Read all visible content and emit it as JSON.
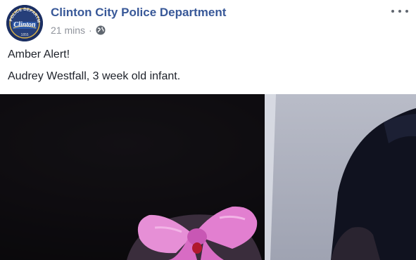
{
  "post": {
    "page_name": "Clinton City Police Department",
    "timestamp": "21 mins",
    "separator": "·",
    "audience_icon": "globe-icon",
    "more_icon": "more-options-icon",
    "avatar": {
      "seal_top_text": "POLICE DEPARTMENT",
      "seal_center_text": "Clinton",
      "seal_bottom_text": "1855"
    },
    "text_lines": [
      "Amber Alert!",
      "Audrey Westfall, 3 week old infant."
    ]
  },
  "colors": {
    "page_name": "#385898",
    "meta": "#90949c",
    "photo_background": "#0f0d10",
    "bow": "#e68fd6"
  }
}
